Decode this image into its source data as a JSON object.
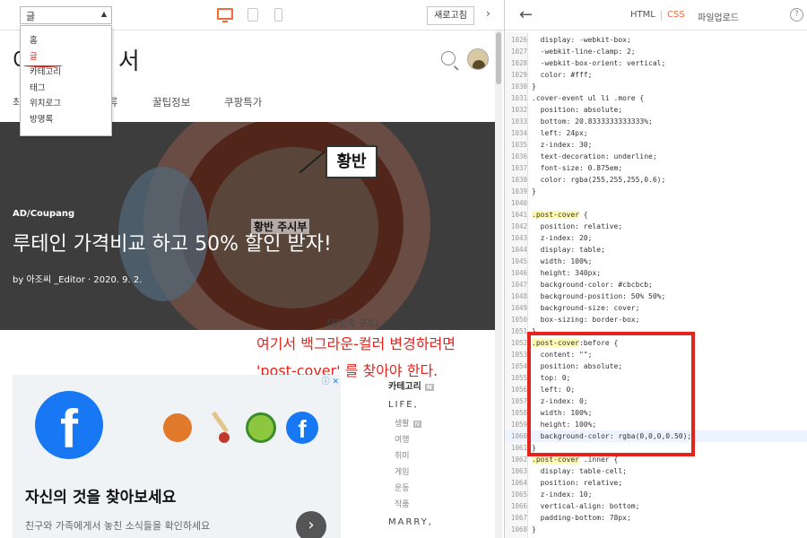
{
  "toolbar": {
    "page_select": "글",
    "refresh_label": "새로고침",
    "collapse": "›"
  },
  "dropdown": {
    "items": [
      "홈",
      "글",
      "카테고리",
      "태그",
      "위치로그",
      "방명록"
    ],
    "selected": "글"
  },
  "blog": {
    "title_left": "아",
    "title_right": "서",
    "nav": [
      "최",
      "류",
      "꿀팁정보",
      "쿠팡특가"
    ]
  },
  "cover": {
    "category": "AD/Coupang",
    "title": "루테인 가격비교 하고 50% 할인 받자!",
    "meta": "by 아조씨 _Editor  ·  2020. 9. 2.",
    "label_hwangban": "황반",
    "label_macula_area": "황반 주시부",
    "caption": "[황반의 구조]"
  },
  "annotation": {
    "line1": "여기서 백그라운-컬러 변경하려면",
    "line2": "'post-cover' 를 찾아야 한다."
  },
  "ad": {
    "adchoices": "ⓘ ✕",
    "headline": "자신의 것을 찾아보세요",
    "description": "친구와 가족에게서 놓친 소식들을 확인하세요",
    "fb_letter": "f",
    "next": "›"
  },
  "categories": {
    "title": "카테고리",
    "badge": "N",
    "groups": [
      {
        "name": "LIFE,",
        "items": [
          "생활",
          "여행",
          "취미",
          "게임",
          "운동",
          "작품"
        ]
      },
      {
        "name": "MARRY,",
        "items": []
      }
    ]
  },
  "editor": {
    "back": "←",
    "tab_html": "HTML",
    "tab_css": "CSS",
    "tab_upload": "파일업로드",
    "help": "?",
    "lines": [
      {
        "n": "1026",
        "t": "  display: -webkit-box;"
      },
      {
        "n": "1027",
        "t": "  -webkit-line-clamp: 2;"
      },
      {
        "n": "1028",
        "t": "  -webkit-box-orient: vertical;"
      },
      {
        "n": "1029",
        "t": "  color: #fff;"
      },
      {
        "n": "1030",
        "t": "}"
      },
      {
        "n": "1031",
        "t": ".cover-event ul li .more {"
      },
      {
        "n": "1032",
        "t": "  position: absolute;"
      },
      {
        "n": "1033",
        "t": "  bottom: 20.8333333333333%;"
      },
      {
        "n": "1034",
        "t": "  left: 24px;"
      },
      {
        "n": "1035",
        "t": "  z-index: 30;"
      },
      {
        "n": "1036",
        "t": "  text-decoration: underline;"
      },
      {
        "n": "1037",
        "t": "  font-size: 0.875em;"
      },
      {
        "n": "1038",
        "t": "  color: rgba(255,255,255,0.6);"
      },
      {
        "n": "1039",
        "t": "}"
      },
      {
        "n": "1040",
        "t": ""
      },
      {
        "n": "1041",
        "t": ".post-cover {"
      },
      {
        "n": "1042",
        "t": "  position: relative;"
      },
      {
        "n": "1043",
        "t": "  z-index: 20;"
      },
      {
        "n": "1044",
        "t": "  display: table;"
      },
      {
        "n": "1045",
        "t": "  width: 100%;"
      },
      {
        "n": "1046",
        "t": "  height: 340px;"
      },
      {
        "n": "1047",
        "t": "  background-color: #cbcbcb;"
      },
      {
        "n": "1048",
        "t": "  background-position: 50% 50%;"
      },
      {
        "n": "1049",
        "t": "  background-size: cover;"
      },
      {
        "n": "1050",
        "t": "  box-sizing: border-box;"
      },
      {
        "n": "1051",
        "t": "}"
      },
      {
        "n": "1052",
        "t": ".post-cover:before {"
      },
      {
        "n": "1053",
        "t": "  content: \"\";"
      },
      {
        "n": "1054",
        "t": "  position: absolute;"
      },
      {
        "n": "1055",
        "t": "  top: 0;"
      },
      {
        "n": "1056",
        "t": "  left: 0;"
      },
      {
        "n": "1057",
        "t": "  z-index: 0;"
      },
      {
        "n": "1058",
        "t": "  width: 100%;"
      },
      {
        "n": "1059",
        "t": "  height: 100%;"
      },
      {
        "n": "1060",
        "t": "  background-color: rgba(0,0,0,0.50);"
      },
      {
        "n": "1061",
        "t": "}"
      },
      {
        "n": "1062",
        "t": ".post-cover .inner {"
      },
      {
        "n": "1063",
        "t": "  display: table-cell;"
      },
      {
        "n": "1064",
        "t": "  position: relative;"
      },
      {
        "n": "1065",
        "t": "  z-index: 10;"
      },
      {
        "n": "1066",
        "t": "  vertical-align: bottom;"
      },
      {
        "n": "1067",
        "t": "  padding-bottom: 78px;"
      },
      {
        "n": "1068",
        "t": "}"
      }
    ]
  },
  "colors": {
    "accent": "#f06b3b",
    "annotation_red": "#e4231d",
    "facebook_blue": "#1877f2"
  }
}
